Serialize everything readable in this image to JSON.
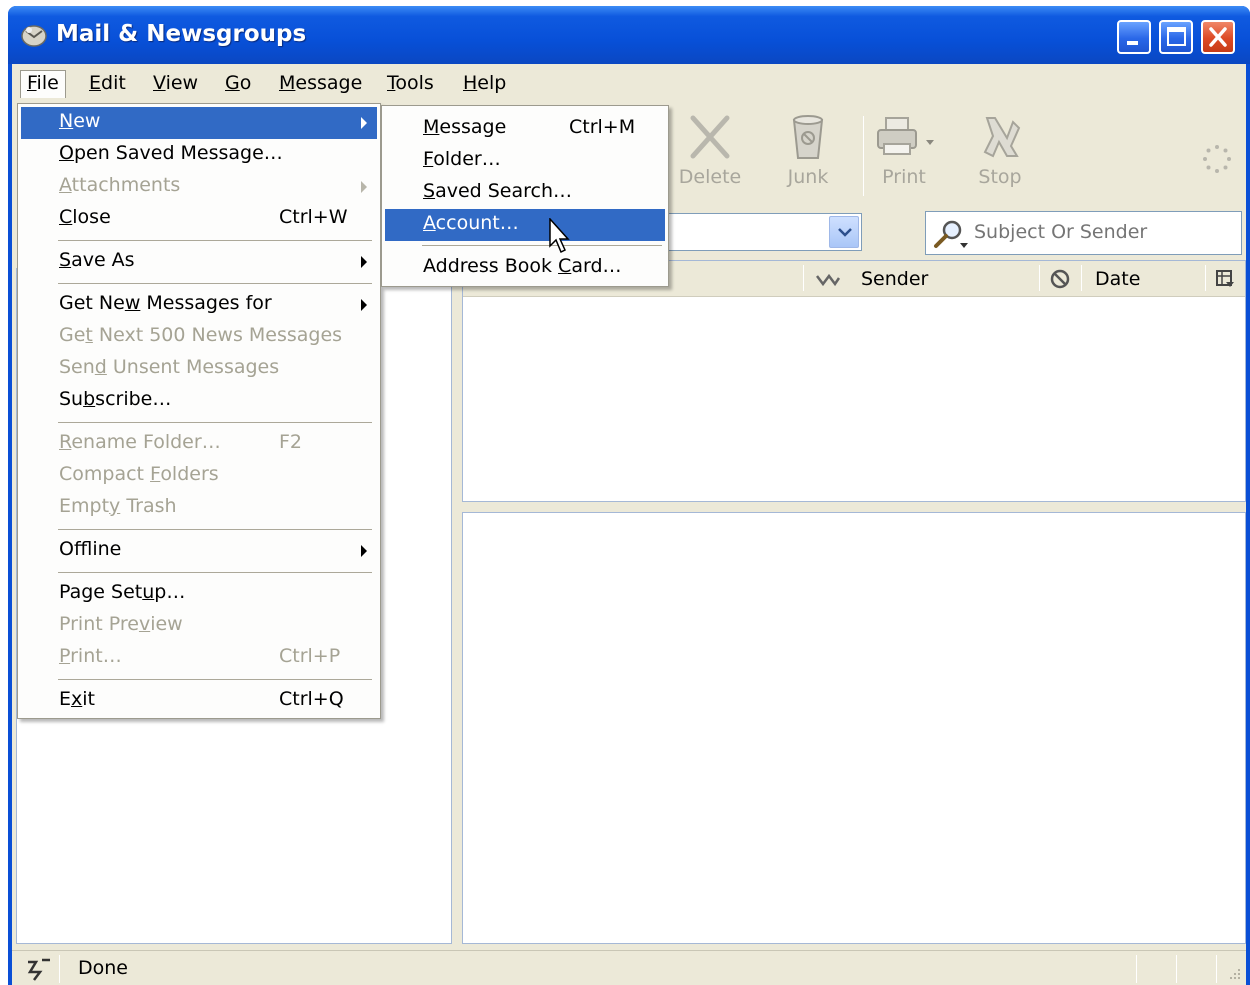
{
  "window": {
    "title": "Mail & Newsgroups"
  },
  "menubar": {
    "items": [
      {
        "label": "File",
        "key": "F",
        "rest": "ile"
      },
      {
        "label": "Edit",
        "key": "E",
        "rest": "dit"
      },
      {
        "label": "View",
        "key": "V",
        "rest": "iew"
      },
      {
        "label": "Go",
        "key": "G",
        "rest": "o"
      },
      {
        "label": "Message",
        "key": "M",
        "rest": "essage"
      },
      {
        "label": "Tools",
        "key": "T",
        "rest": "ools"
      },
      {
        "label": "Help",
        "key": "H",
        "rest": "elp"
      }
    ]
  },
  "toolbar": {
    "delete": "Delete",
    "junk": "Junk",
    "print": "Print",
    "stop": "Stop"
  },
  "search": {
    "placeholder": "Subject Or Sender"
  },
  "columns": {
    "sender": "Sender",
    "date": "Date"
  },
  "status": {
    "text": "Done"
  },
  "file_menu": {
    "new": {
      "pre": "",
      "key": "N",
      "post": "ew"
    },
    "open_saved": {
      "pre": "",
      "key": "O",
      "post": "pen Saved Message…"
    },
    "attachments": {
      "pre": "",
      "key": "A",
      "post": "ttachments"
    },
    "close": {
      "pre": "",
      "key": "C",
      "post": "lose",
      "shortcut": "Ctrl+W"
    },
    "save_as": {
      "pre": "",
      "key": "S",
      "post": "ave As"
    },
    "get_new": {
      "pre": "Get Ne",
      "key": "w",
      "post": " Messages for"
    },
    "get_next": {
      "pre": "Ge",
      "key": "t",
      "post": " Next 500 News Messages"
    },
    "send_unsent": {
      "pre": "Sen",
      "key": "d",
      "post": " Unsent Messages"
    },
    "subscribe": {
      "pre": "Su",
      "key": "b",
      "post": "scribe…"
    },
    "rename": {
      "pre": "",
      "key": "R",
      "post": "ename Folder…",
      "shortcut": "F2"
    },
    "compact": {
      "pre": "Compact ",
      "key": "F",
      "post": "olders"
    },
    "empty_trash": {
      "pre": "Empt",
      "key": "y",
      "post": " Trash"
    },
    "offline": {
      "pre": "Off",
      "key": "l",
      "post": "ine"
    },
    "page_setup": {
      "pre": "Page Set",
      "key": "u",
      "post": "p…"
    },
    "print_preview": {
      "pre": "Print Pre",
      "key": "v",
      "post": "iew"
    },
    "print": {
      "pre": "",
      "key": "P",
      "post": "rint…",
      "shortcut": "Ctrl+P"
    },
    "exit": {
      "pre": "E",
      "key": "x",
      "post": "it",
      "shortcut": "Ctrl+Q"
    }
  },
  "new_submenu": {
    "message": {
      "pre": "",
      "key": "M",
      "post": "essage",
      "shortcut": "Ctrl+M"
    },
    "folder": {
      "pre": "",
      "key": "F",
      "post": "older…"
    },
    "saved_search": {
      "pre": "",
      "key": "S",
      "post": "aved Search…"
    },
    "account": {
      "pre": "",
      "key": "A",
      "post": "ccount…"
    },
    "address_card": {
      "pre": "Address Book ",
      "key": "C",
      "post": "ard…"
    }
  },
  "colors": {
    "titlebar": "#0a4fd6",
    "menu_highlight": "#316ac5",
    "chrome": "#ece9d8",
    "disabled_text": "#a5a394"
  }
}
